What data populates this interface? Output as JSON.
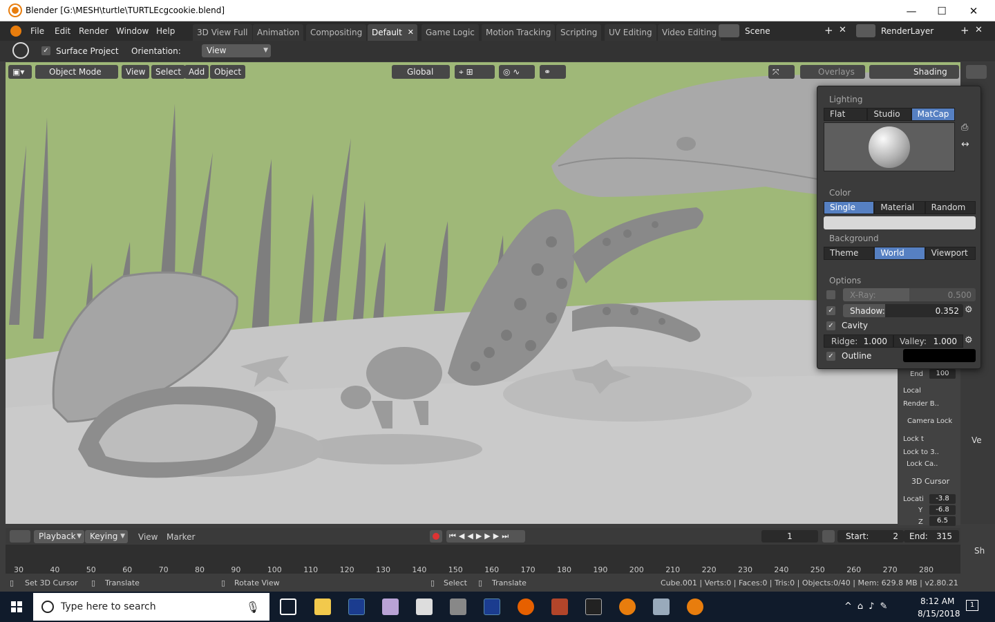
{
  "window": {
    "title": "Blender [G:\\MESH\\turtle\\TURTLEcgcookie.blend]",
    "controls": {
      "minimize": "—",
      "maximize": "☐",
      "close": "✕"
    }
  },
  "menu": [
    "File",
    "Edit",
    "Render",
    "Window",
    "Help"
  ],
  "workspaces": [
    {
      "label": "3D View Full"
    },
    {
      "label": "Animation"
    },
    {
      "label": "Compositing"
    },
    {
      "label": "Default",
      "active": true
    },
    {
      "label": "Game Logic"
    },
    {
      "label": "Motion Tracking"
    },
    {
      "label": "Scripting"
    },
    {
      "label": "UV Editing"
    },
    {
      "label": "Video Editing"
    }
  ],
  "scene": {
    "label": "Scene",
    "renderlayer": "RenderLayer"
  },
  "tool_settings": {
    "surface_project": "Surface Project",
    "orientation_label": "Orientation:",
    "orientation_value": "View"
  },
  "viewport_header": {
    "mode": "Object Mode",
    "menus": [
      "View",
      "Select",
      "Add",
      "Object"
    ],
    "transform": "Global",
    "overlays": "Overlays",
    "shading": "Shading"
  },
  "shading_popover": {
    "lighting_label": "Lighting",
    "lighting_options": [
      "Flat",
      "Studio",
      "MatCap"
    ],
    "lighting_active": "MatCap",
    "color_label": "Color",
    "color_options": [
      "Single",
      "Material",
      "Random"
    ],
    "color_active": "Single",
    "background_label": "Background",
    "background_options": [
      "Theme",
      "World",
      "Viewport"
    ],
    "background_active": "World",
    "options_label": "Options",
    "xray": {
      "label": "X-Ray:",
      "value": "0.500",
      "fraction": 0.5,
      "checked": false
    },
    "shadow": {
      "label": "Shadow:",
      "value": "0.352",
      "fraction": 0.352,
      "checked": true
    },
    "cavity": {
      "label": "Cavity",
      "checked": true
    },
    "ridge": {
      "label": "Ridge:",
      "value": "1.000"
    },
    "valley": {
      "label": "Valley:",
      "value": "1.000"
    },
    "outline": {
      "label": "Outline",
      "checked": true
    }
  },
  "npanel": {
    "end_label": "End",
    "end_value": "100",
    "local_label": "Local",
    "render_label": "Render B..",
    "camera_lock": "Camera Lock",
    "lock_t": "Lock t",
    "lock_to_3": "Lock to 3..",
    "lock_ca": "Lock Ca..",
    "cursor_header": "3D Cursor",
    "location_label": "Locati",
    "x": "-3.8",
    "y_label": "Y",
    "y": "-6.8",
    "z_label": "Z",
    "z": "6.5"
  },
  "right_strip": {
    "ve": "Ve",
    "sh": "Sh"
  },
  "timeline": {
    "playback": "Playback",
    "keying": "Keying",
    "view": "View",
    "marker": "Marker",
    "current_frame": "1",
    "start_label": "Start:",
    "start": "2",
    "end_label": "End:",
    "end": "315",
    "ticks": [
      "30",
      "40",
      "50",
      "60",
      "70",
      "80",
      "90",
      "100",
      "110",
      "120",
      "130",
      "140",
      "150",
      "160",
      "170",
      "180",
      "190",
      "200",
      "210",
      "220",
      "230",
      "240",
      "250",
      "260",
      "270",
      "280"
    ]
  },
  "status": {
    "set_cursor": "Set 3D Cursor",
    "translate1": "Translate",
    "rotate": "Rotate View",
    "select": "Select",
    "translate2": "Translate",
    "info": "Cube.001 | Verts:0 | Faces:0 | Tris:0 | Objects:0/40 | Mem: 629.8 MB | v2.80.21"
  },
  "taskbar": {
    "search_placeholder": "Type here to search",
    "time": "8:12 AM",
    "date": "8/15/2018",
    "notif": "1"
  },
  "colors": {
    "accent": "#5680c2",
    "sky": "#9fb878",
    "ground": "#c8c8c8"
  }
}
